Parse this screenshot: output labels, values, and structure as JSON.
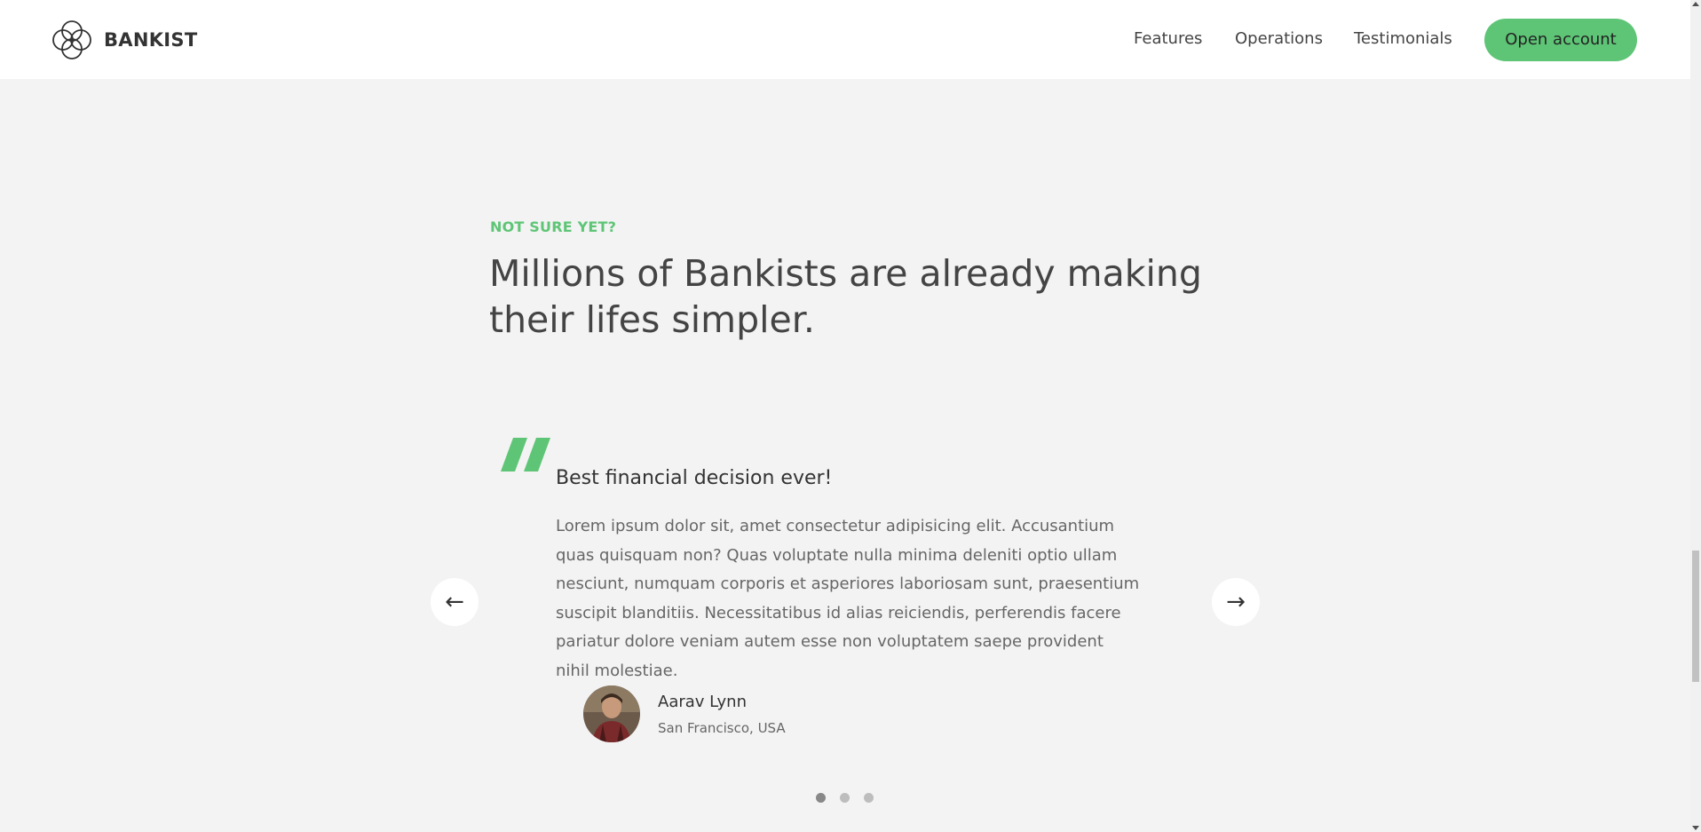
{
  "nav": {
    "brand": "BANKIST",
    "links": [
      "Features",
      "Operations",
      "Testimonials"
    ],
    "cta": "Open account"
  },
  "section": {
    "tag": "NOT SURE YET?",
    "title": "Millions of Bankists are already making their lifes simpler."
  },
  "testimonial": {
    "heading": "Best financial decision ever!",
    "text": "Lorem ipsum dolor sit, amet consectetur adipisicing elit. Accusantium quas quisquam non? Quas voluptate nulla minima deleniti optio ullam nesciunt, numquam corporis et asperiores laboriosam sunt, praesentium suscipit blanditiis. Necessitatibus id alias reiciendis, perferendis facere pariatur dolore veniam autem esse non voluptatem saepe provident nihil molestiae.",
    "author": "Aarav Lynn",
    "location": "San Francisco, USA"
  },
  "slider": {
    "prev_label": "←",
    "next_label": "→",
    "active_dot": 1,
    "dot_count": 3
  },
  "colors": {
    "accent": "#5ec576",
    "background": "#f3f3f3"
  },
  "icons": {
    "logo": "bankist-logo-icon",
    "quote": "quote-mark-icon"
  }
}
